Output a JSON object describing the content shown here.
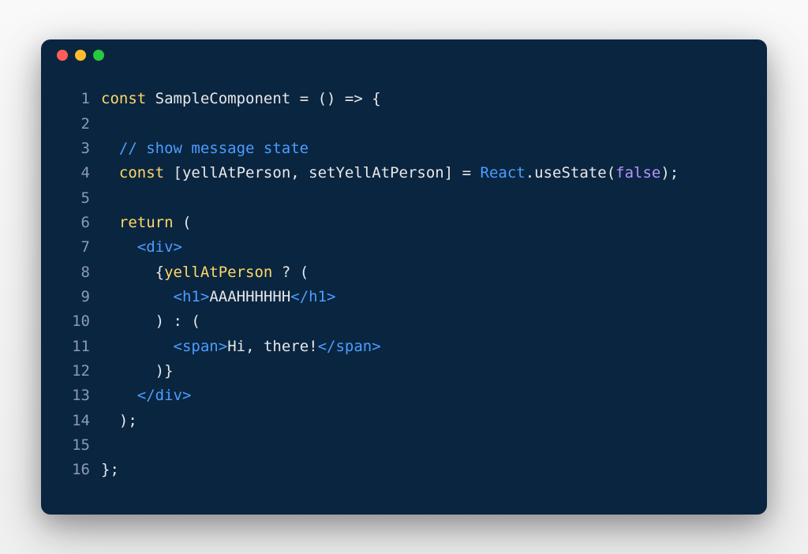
{
  "window": {
    "traffic_lights": {
      "red": "#ff5f56",
      "yellow": "#ffbd2e",
      "green": "#27c93f"
    }
  },
  "code": {
    "language": "jsx",
    "lines": {
      "n1": "1",
      "n2": "2",
      "n3": "3",
      "n4": "4",
      "n5": "5",
      "n6": "6",
      "n7": "7",
      "n8": "8",
      "n9": "9",
      "n10": "10",
      "n11": "11",
      "n12": "12",
      "n13": "13",
      "n14": "14",
      "n15": "15",
      "n16": "16"
    },
    "l1": {
      "const": "const",
      "name": "SampleComponent",
      "eq": " = ",
      "paren": "()",
      "arrow": " => ",
      "brace": "{"
    },
    "l3": {
      "comment": "// show message state"
    },
    "l4": {
      "const": "const",
      "open_bracket": " [",
      "var1": "yellAtPerson",
      "comma": ", ",
      "var2": "setYellAtPerson",
      "close_bracket": "] = ",
      "react": "React",
      "dot": ".",
      "method": "useState",
      "open_paren": "(",
      "bool": "false",
      "close": ");"
    },
    "l6": {
      "return": "return",
      "paren": " ("
    },
    "l7": {
      "open": "<",
      "tag": "div",
      "close": ">"
    },
    "l8": {
      "brace": "{",
      "var": "yellAtPerson",
      "ternary": " ? ("
    },
    "l9": {
      "open": "<",
      "tag_open": "h1",
      "gt": ">",
      "text": "AAAHHHHHH",
      "close_open": "</",
      "tag_close": "h1",
      "close": ">"
    },
    "l10": {
      "text": ") : ("
    },
    "l11": {
      "open": "<",
      "tag_open": "span",
      "gt": ">",
      "text": "Hi, there!",
      "close_open": "</",
      "tag_close": "span",
      "close": ">"
    },
    "l12": {
      "text": ")}"
    },
    "l13": {
      "open": "</",
      "tag": "div",
      "close": ">"
    },
    "l14": {
      "text": ");"
    },
    "l16": {
      "text": "};"
    }
  }
}
